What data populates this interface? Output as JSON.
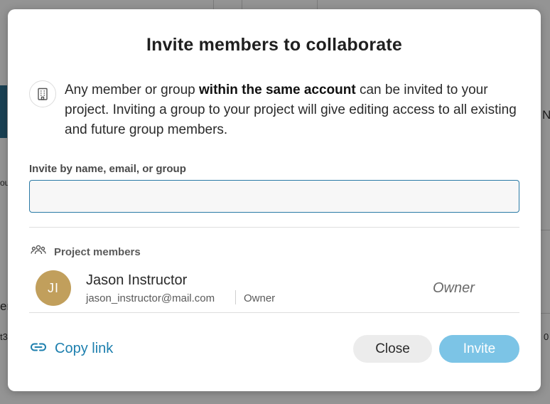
{
  "background": {
    "edge_texts": [
      "N",
      "ou",
      "en",
      "t3",
      "0"
    ]
  },
  "modal": {
    "title": "Invite members to collaborate",
    "info": {
      "icon": "building-icon",
      "text_before": "Any member or group ",
      "text_bold": "within the same account",
      "text_after": " can be invited to your project. Inviting a group to your project will give editing access to all existing and future group members."
    },
    "invite_field": {
      "label": "Invite by name, email, or group",
      "value": "",
      "placeholder": ""
    },
    "members": {
      "icon": "group-icon",
      "header": "Project members",
      "list": [
        {
          "initials": "JI",
          "name": "Jason Instructor",
          "email": "jason_instructor@mail.com",
          "role_small": "Owner",
          "role": "Owner",
          "avatar_color": "#c19f5c"
        }
      ]
    },
    "copy_link": {
      "icon": "link-icon",
      "label": "Copy link"
    },
    "buttons": {
      "close": "Close",
      "invite": "Invite"
    }
  },
  "colors": {
    "accent": "#1d7fae",
    "input_border": "#2a7aa5",
    "invite_button_disabled": "#7cc4e6",
    "close_button": "#ececec"
  }
}
